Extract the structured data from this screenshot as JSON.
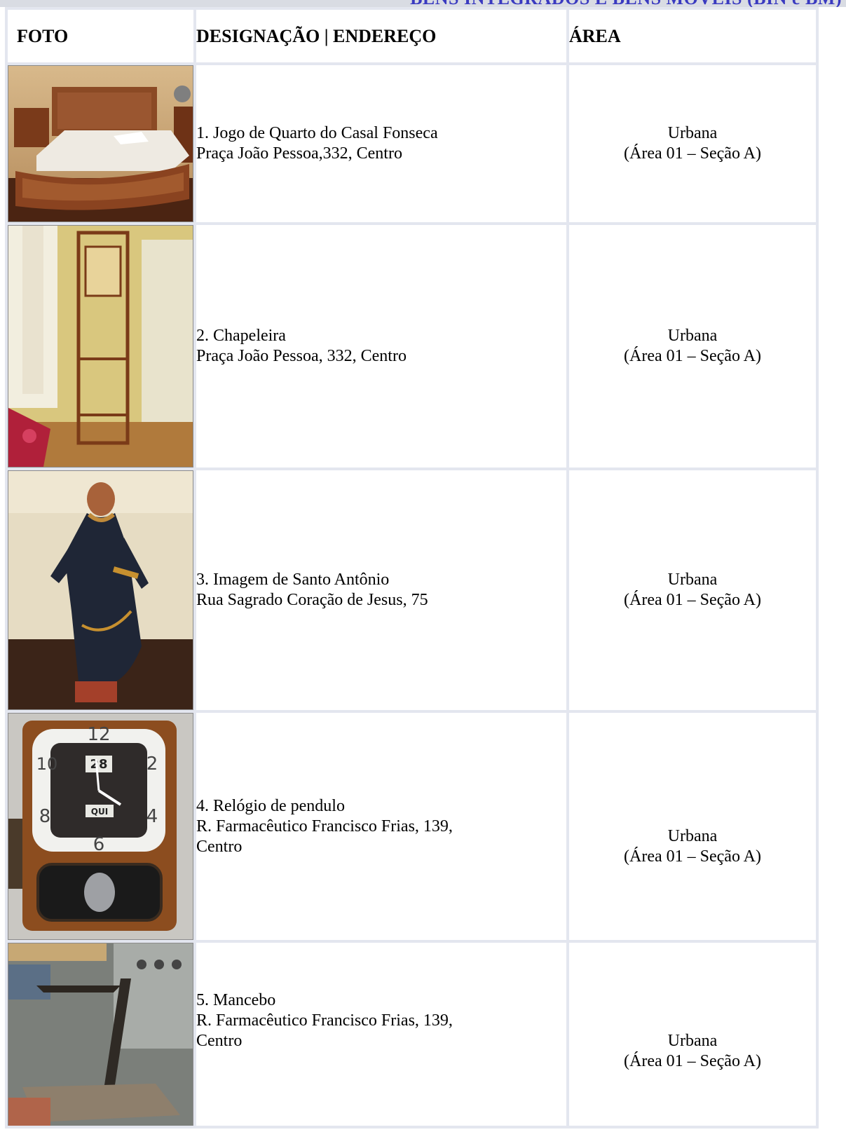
{
  "header": {
    "section_title": "BENS INTEGRADOS E BENS MÓVEIS (BIN e BM)"
  },
  "table": {
    "columns": [
      "FOTO",
      "DESIGNAÇÃO | ENDEREÇO",
      "ÁREA"
    ],
    "rows": [
      {
        "photo": "bed-set-photo",
        "designation": "1. Jogo de Quarto do Casal Fonseca",
        "address": [
          "Praça João Pessoa,332, Centro"
        ],
        "area": "Urbana",
        "area_detail": "(Área 01 – Seção A)"
      },
      {
        "photo": "hat-stand-photo",
        "designation": "2.  Chapeleira",
        "address": [
          "Praça João Pessoa, 332, Centro"
        ],
        "area": "Urbana",
        "area_detail": "(Área 01 – Seção A)"
      },
      {
        "photo": "saint-statue-photo",
        "designation": "3. Imagem de Santo Antônio",
        "address": [
          "Rua Sagrado Coração de Jesus, 75"
        ],
        "area": "Urbana",
        "area_detail": "(Área 01 – Seção A)"
      },
      {
        "photo": "pendulum-clock-photo",
        "designation": "4. Relógio de pendulo",
        "address": [
          "R. Farmacêutico Francisco Frias, 139,",
          "Centro"
        ],
        "area": "Urbana",
        "area_detail": "(Área 01 – Seção A)"
      },
      {
        "photo": "valet-stand-photo",
        "designation": "5.  Mancebo",
        "address": [
          "R. Farmacêutico Francisco Frias, 139,",
          "Centro"
        ],
        "area": "Urbana",
        "area_detail": "(Área 01 – Seção A)"
      }
    ],
    "clock_face": {
      "numerals": [
        "12",
        "2",
        "4",
        "6",
        "8",
        "10"
      ],
      "date": "28",
      "day": "QUI"
    }
  }
}
